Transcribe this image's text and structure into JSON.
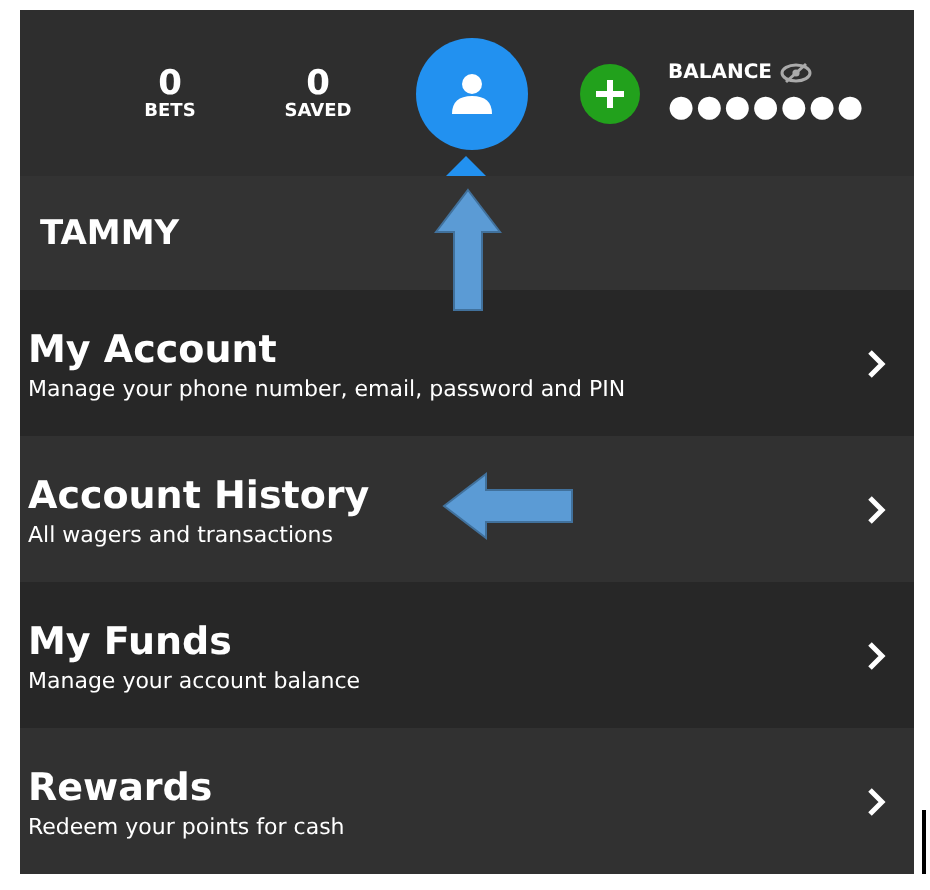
{
  "header": {
    "stats": [
      {
        "value": "0",
        "label": "BETS"
      },
      {
        "value": "0",
        "label": "SAVED"
      }
    ],
    "balance": {
      "label": "BALANCE",
      "value": "●●●●●●●"
    }
  },
  "user": {
    "name": "TAMMY"
  },
  "menu": [
    {
      "title": "My Account",
      "subtitle": "Manage your phone number, email, password and PIN"
    },
    {
      "title": "Account History",
      "subtitle": "All wagers and transactions"
    },
    {
      "title": "My Funds",
      "subtitle": "Manage your account balance"
    },
    {
      "title": "Rewards",
      "subtitle": "Redeem your points for cash"
    }
  ],
  "annotations": [
    {
      "kind": "up"
    },
    {
      "kind": "left"
    }
  ]
}
